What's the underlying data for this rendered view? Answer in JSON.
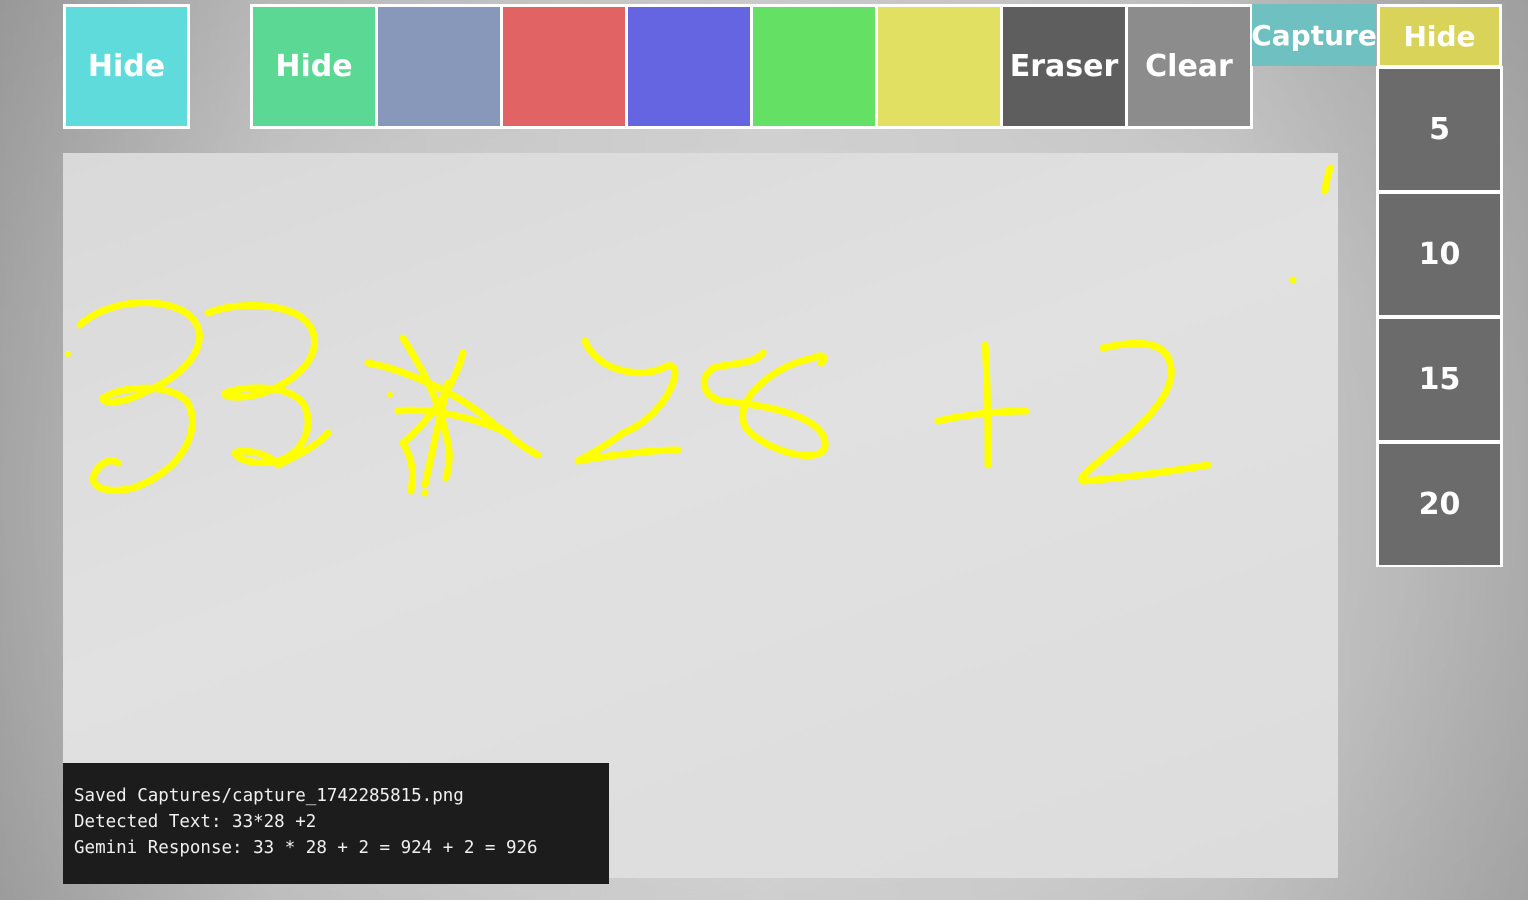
{
  "toolbar": {
    "hide_left_label": "Hide",
    "hide_left_color": "#5fdbdc",
    "palette": [
      {
        "label": "Hide",
        "color": "#5bd893",
        "name": "palette-hide-button"
      },
      {
        "label": "",
        "color": "#8898bb",
        "name": "color-swatch-slate"
      },
      {
        "label": "",
        "color": "#e26363",
        "name": "color-swatch-red"
      },
      {
        "label": "",
        "color": "#6565e1",
        "name": "color-swatch-blue"
      },
      {
        "label": "",
        "color": "#64e164",
        "name": "color-swatch-green"
      },
      {
        "label": "",
        "color": "#e1e063",
        "name": "color-swatch-yellow"
      },
      {
        "label": "Eraser",
        "color": "#5e5e5e",
        "name": "eraser-button"
      },
      {
        "label": "Clear",
        "color": "#8c8c8c",
        "name": "clear-button"
      }
    ],
    "capture_label": "Capture",
    "capture_color": "#6fc1c1",
    "hide_right_label": "Hide",
    "hide_right_color": "#d9d35a"
  },
  "brush_sizes": {
    "color": "#6b6b6b",
    "items": [
      "5",
      "10",
      "15",
      "20"
    ]
  },
  "drawing": {
    "stroke_color": "#ffff00"
  },
  "console": {
    "lines": [
      "Saved Captures/capture_1742285815.png",
      "Detected Text: 33*28 +2",
      "Gemini Response: 33 * 28 + 2 = 924 + 2 = 926"
    ]
  }
}
